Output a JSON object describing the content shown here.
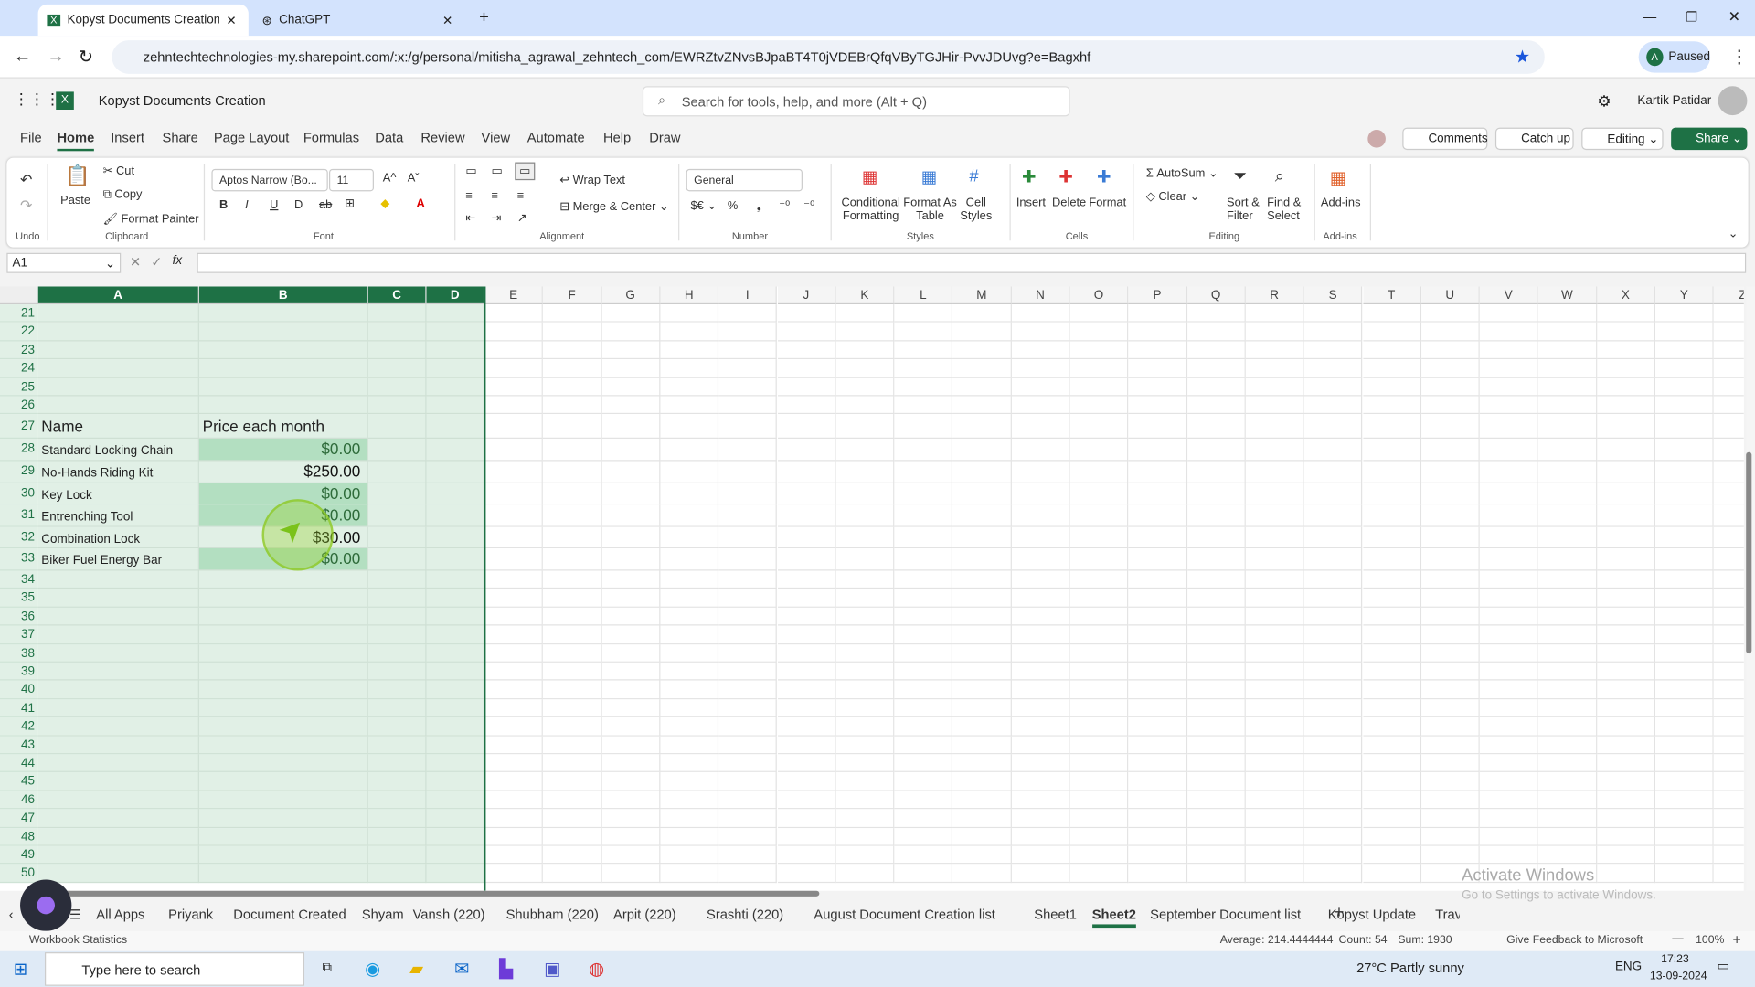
{
  "browser": {
    "tabs": [
      {
        "label": "Kopyst Documents Creation.xlsx"
      },
      {
        "label": "ChatGPT"
      }
    ],
    "url": "zehntechtechnologies-my.sharepoint.com/:x:/g/personal/mitisha_agrawal_zehntech_com/EWRZtvZNvsBJpaBT4T0jVDEBrQfqVByTGJHir-PvvJDUvg?e=Bagxhf",
    "profile": "Paused",
    "profile_initial": "A"
  },
  "app": {
    "doc_title": "Kopyst Documents Creation",
    "search_placeholder": "Search for tools, help, and more (Alt + Q)",
    "user": "Kartik Patidar"
  },
  "menu": [
    "File",
    "Home",
    "Insert",
    "Share",
    "Page Layout",
    "Formulas",
    "Data",
    "Review",
    "View",
    "Automate",
    "Help",
    "Draw"
  ],
  "menu_active": "Home",
  "actions": {
    "comments": "Comments",
    "catchup": "Catch up",
    "editing": "Editing",
    "share": "Share"
  },
  "ribbon": {
    "undo": "Undo",
    "paste": "Paste",
    "cut": "Cut",
    "copy": "Copy",
    "format_painter": "Format Painter",
    "clipboard": "Clipboard",
    "font_name": "Aptos Narrow (Bo...",
    "font_size": "11",
    "font": "Font",
    "wrap": "Wrap Text",
    "merge": "Merge & Center",
    "alignment": "Alignment",
    "number_format": "General",
    "number": "Number",
    "cond": "Conditional Formatting",
    "fmt_table": "Format As Table",
    "cell_styles": "Cell Styles",
    "styles": "Styles",
    "insert": "Insert",
    "delete": "Delete",
    "format": "Format",
    "cells": "Cells",
    "autosum": "AutoSum",
    "clear": "Clear",
    "sort": "Sort & Filter",
    "find": "Find & Select",
    "editing": "Editing",
    "addins": "Add-ins",
    "addins_grp": "Add-ins"
  },
  "formula": {
    "name_box": "A1",
    "value": ""
  },
  "columns": [
    "A",
    "B",
    "C",
    "D",
    "E",
    "F",
    "G",
    "H",
    "I",
    "J",
    "K",
    "L",
    "M",
    "N",
    "O",
    "P",
    "Q",
    "R",
    "S",
    "T",
    "U",
    "V",
    "W",
    "X",
    "Y",
    "Z"
  ],
  "selected_columns": [
    "A",
    "B",
    "C",
    "D"
  ],
  "rows": [
    21,
    22,
    23,
    24,
    25,
    26,
    27,
    28,
    29,
    30,
    31,
    32,
    33,
    34,
    35,
    36,
    37,
    38,
    39,
    40,
    41,
    42,
    43,
    44,
    45,
    46,
    47,
    48,
    49,
    50
  ],
  "table": {
    "header": [
      "Name",
      "Price each month"
    ],
    "items": [
      {
        "row": 28,
        "name": "Standard Locking Chain",
        "price": "$0.00",
        "highlight": true
      },
      {
        "row": 29,
        "name": "No-Hands Riding Kit",
        "price": "$250.00",
        "highlight": false
      },
      {
        "row": 30,
        "name": "Key Lock",
        "price": "$0.00",
        "highlight": true
      },
      {
        "row": 31,
        "name": "Entrenching Tool",
        "price": "$0.00",
        "highlight": true
      },
      {
        "row": 32,
        "name": "Combination Lock",
        "price": "$30.00",
        "highlight": false
      },
      {
        "row": 33,
        "name": "Biker Fuel Energy Bar",
        "price": "$0.00",
        "highlight": true
      }
    ]
  },
  "sheets": [
    "All Apps",
    "Priyank",
    "Document Created",
    "Shyam",
    "Vansh (220)",
    "Shubham (220)",
    "Arpit (220)",
    "Srashti (220)",
    "August Document Creation list",
    "Sheet1",
    "Sheet2",
    "September Document list",
    "Kopyst Update",
    "Trav"
  ],
  "active_sheet": "Sheet2",
  "watermark": {
    "title": "Activate Windows",
    "sub": "Go to Settings to activate Windows."
  },
  "status": {
    "left": "Workbook Statistics",
    "average": "Average: 214.4444444",
    "count": "Count: 54",
    "sum": "Sum: 1930",
    "feedback": "Give Feedback to Microsoft",
    "zoom": "100%"
  },
  "taskbar": {
    "search": "Type here to search",
    "weather": "27°C  Partly sunny",
    "lang": "ENG",
    "time": "17:23",
    "date": "13-09-2024"
  },
  "colors": {
    "excel_green": "#1e7145",
    "selection": "#e1f0e6",
    "highlight": "#b3dfc1",
    "price_green": "#2e6b3a"
  }
}
